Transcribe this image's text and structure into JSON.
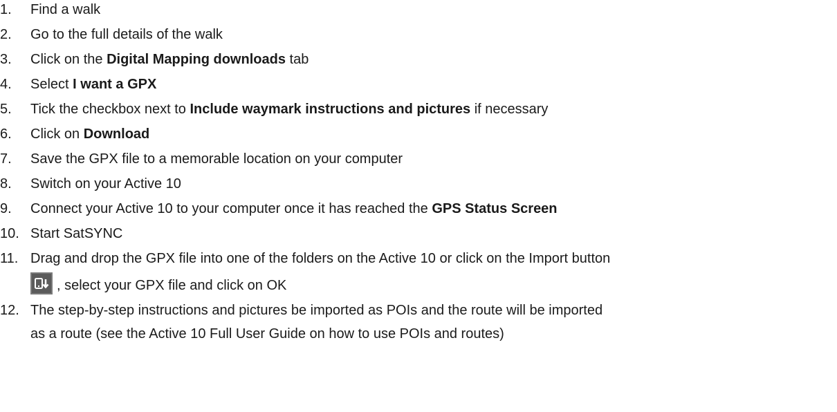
{
  "steps": [
    {
      "num": "1.",
      "segments": [
        "Find a walk"
      ]
    },
    {
      "num": "2.",
      "segments": [
        "Go to the full details of the walk"
      ]
    },
    {
      "num": "3.",
      "segments": [
        "Click on the ",
        "Digital Mapping downloads",
        " tab"
      ]
    },
    {
      "num": "4.",
      "segments": [
        "Select ",
        "I want a GPX"
      ]
    },
    {
      "num": "5.",
      "segments": [
        "Tick the checkbox next to ",
        "Include waymark instructions and pictures",
        " if necessary"
      ]
    },
    {
      "num": "6.",
      "segments": [
        "Click on ",
        "Download"
      ]
    },
    {
      "num": "7.",
      "segments": [
        "Save the GPX file to a memorable location on your computer"
      ]
    },
    {
      "num": "8.",
      "segments": [
        "Switch on your Active 10"
      ]
    },
    {
      "num": "9.",
      "segments": [
        "Connect your Active 10 to your computer once it has reached the ",
        "GPS Status Screen"
      ]
    },
    {
      "num": "10.",
      "segments": [
        "Start SatSYNC"
      ]
    },
    {
      "num": "11.",
      "line1": "Drag and drop the GPX file into one of the folders on the Active 10 or click on the Import button",
      "line2": ", select your GPX file and click on OK",
      "icon": "import-button-icon"
    },
    {
      "num": "12.",
      "line1": "The step-by-step instructions and pictures be imported as POIs and the route will be imported",
      "line2": "as a route (see the Active 10 Full User Guide on how to use POIs and routes)"
    }
  ]
}
